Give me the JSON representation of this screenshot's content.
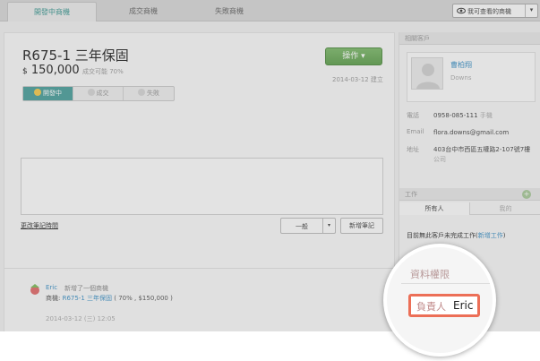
{
  "tabs": [
    {
      "label": "開發中商機",
      "active": true
    },
    {
      "label": "成交商機",
      "active": false
    },
    {
      "label": "失敗商機",
      "active": false
    }
  ],
  "view_filter": {
    "label": "我可查看的商機",
    "icon": "eye-icon"
  },
  "deal": {
    "title": "R675-1 三年保固",
    "currency": "$",
    "amount": "150,000",
    "probability": "成交可能 70%",
    "action_label": "操作",
    "created": "2014-03-12 建立",
    "statuses": [
      {
        "label": "開發中",
        "active": true
      },
      {
        "label": "成交",
        "active": false
      },
      {
        "label": "失敗",
        "active": false
      }
    ]
  },
  "notes": {
    "edit_time_link": "更改筆記時間",
    "type_select": "一般",
    "add_button": "新增筆記"
  },
  "feed": {
    "author": "Eric",
    "action": "新增了一個商機",
    "line2_prefix": "商機:",
    "deal_link": "R675-1 三年保固",
    "line2_suffix": "( 70% , $150,000 )",
    "time": "2014-03-12 (三) 12:05"
  },
  "sidebar": {
    "contact_header": "相關客戶",
    "contact_name": "曹柏翔",
    "contact_alias": "Downs",
    "phone_key": "電話",
    "phone_value": "0958-085-111",
    "phone_type": "手機",
    "email_key": "Email",
    "email_value": "flora.downs@gmail.com",
    "address_key": "地址",
    "address_value": "403台中市西區五權路2-107號7樓",
    "address_type": "公司",
    "tasks_header": "工作",
    "task_tabs": [
      {
        "label": "所有人",
        "active": true
      },
      {
        "label": "我的",
        "active": false
      }
    ],
    "task_empty_text": "目前無此客戶未完成工作(",
    "task_new_link": "新增工作",
    "task_empty_close": ")"
  },
  "magnifier": {
    "title": "資料權限",
    "owner_label": "負責人",
    "owner_value": "Eric"
  },
  "colors": {
    "accent": "#4a9e9a",
    "action_green": "#6aab57",
    "link": "#3b8fc4",
    "highlight": "#ec6f57"
  }
}
